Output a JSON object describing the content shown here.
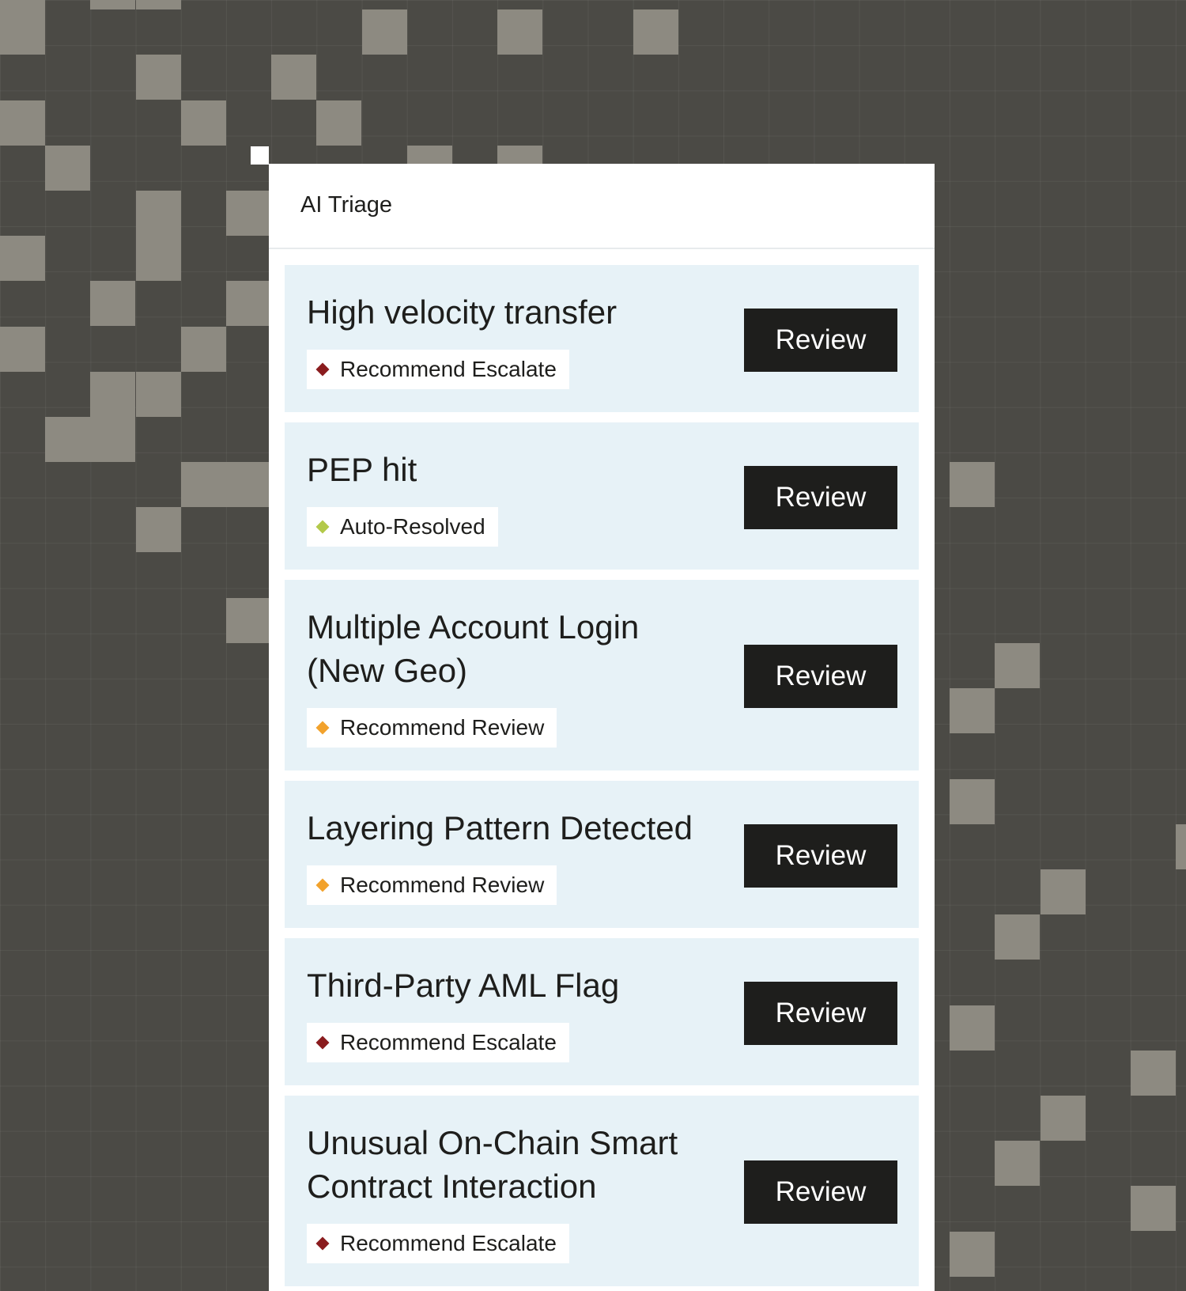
{
  "panel": {
    "title": "AI Triage"
  },
  "status_colors": {
    "escalate": "#8a1c1e",
    "auto_resolved": "#b3c94a",
    "review": "#f2a22c"
  },
  "items": [
    {
      "title": "High velocity transfer",
      "status": "Recommend Escalate",
      "status_icon": "diamond-icon",
      "status_color": "#8a1c1e",
      "action": "Review"
    },
    {
      "title": "PEP hit",
      "status": "Auto-Resolved",
      "status_icon": "diamond-icon",
      "status_color": "#b3c94a",
      "action": "Review"
    },
    {
      "title": "Multiple Account Login (New Geo)",
      "status": "Recommend Review",
      "status_icon": "diamond-icon",
      "status_color": "#f2a22c",
      "action": "Review"
    },
    {
      "title": "Layering Pattern Detected",
      "status": "Recommend Review",
      "status_icon": "diamond-icon",
      "status_color": "#f2a22c",
      "action": "Review"
    },
    {
      "title": "Third-Party AML Flag",
      "status": "Recommend Escalate",
      "status_icon": "diamond-icon",
      "status_color": "#8a1c1e",
      "action": "Review"
    },
    {
      "title": "Unusual On-Chain Smart Contract Interaction",
      "status": "Recommend Escalate",
      "status_icon": "diamond-icon",
      "status_color": "#8a1c1e",
      "action": "Review"
    }
  ]
}
